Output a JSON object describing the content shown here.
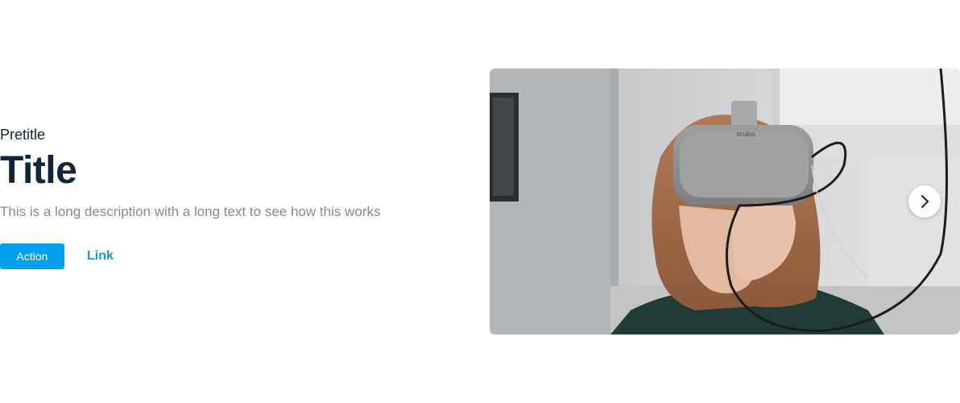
{
  "hero": {
    "pretitle": "Pretitle",
    "title": "Title",
    "description": "This is a long description with a long text to see how this works",
    "primary_action_label": "Action",
    "link_label": "Link"
  },
  "media": {
    "image_alt": "Person wearing a VR headset",
    "headset_brand": "oculus",
    "next_icon": "chevron-right-icon"
  },
  "colors": {
    "title": "#10243a",
    "description": "#8a8a8a",
    "button": "#00a0f0",
    "link": "#0a9bd8"
  }
}
